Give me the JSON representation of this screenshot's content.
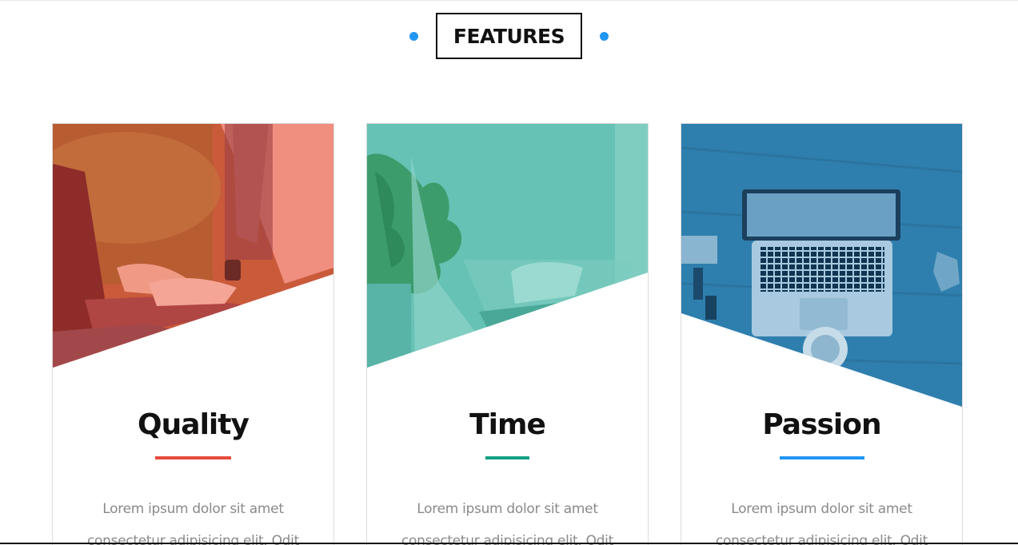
{
  "section": {
    "title": "FEATURES",
    "accent_color": "#2196f3"
  },
  "cards": [
    {
      "title": "Quality",
      "text_line_1": "Lorem ipsum dolor sit amet",
      "text_line_2": "consectetur adipisicing elit. Odit",
      "overlay_color": "#e0533f",
      "underline_color": "#e74c3c",
      "image": "woman-typing-laptop-photo"
    },
    {
      "title": "Time",
      "text_line_1": "Lorem ipsum dolor sit amet",
      "text_line_2": "consectetur adipisicing elit. Odit",
      "overlay_color": "#5cbfb0",
      "underline_color": "#16a085",
      "image": "hands-on-laptop-plant-photo"
    },
    {
      "title": "Passion",
      "text_line_1": "Lorem ipsum dolor sit amet",
      "text_line_2": "consectetur adipisicing elit. Odit",
      "overlay_color": "#2f86b8",
      "underline_color": "#2196f3",
      "image": "laptop-on-desk-photo"
    }
  ]
}
